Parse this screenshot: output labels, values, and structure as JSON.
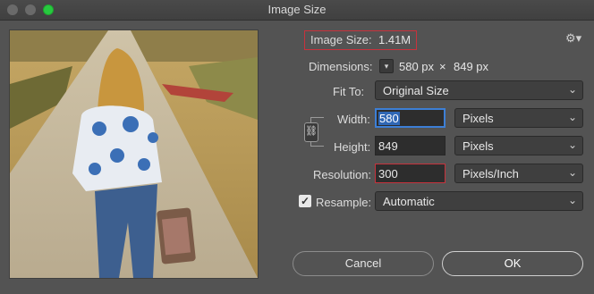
{
  "window": {
    "title": "Image Size"
  },
  "image_size": {
    "label": "Image Size:",
    "value": "1.41M"
  },
  "dimensions": {
    "label": "Dimensions:",
    "width": "580 px",
    "times": "×",
    "height": "849 px"
  },
  "fit_to": {
    "label": "Fit To:",
    "value": "Original Size"
  },
  "width": {
    "label": "Width:",
    "value": "580",
    "unit": "Pixels"
  },
  "height": {
    "label": "Height:",
    "value": "849",
    "unit": "Pixels"
  },
  "resolution": {
    "label": "Resolution:",
    "value": "300",
    "unit": "Pixels/Inch"
  },
  "resample": {
    "label": "Resample:",
    "value": "Automatic",
    "checked": true
  },
  "buttons": {
    "cancel": "Cancel",
    "ok": "OK"
  },
  "icons": {
    "gear": "gear-icon",
    "chevron": "chevron-icon",
    "chain": "link-icon",
    "check": "checkmark-icon"
  },
  "colors": {
    "background": "#535353",
    "focus": "#3d7fd6",
    "highlight_box": "#c8323c",
    "traffic_green": "#27c93f"
  }
}
